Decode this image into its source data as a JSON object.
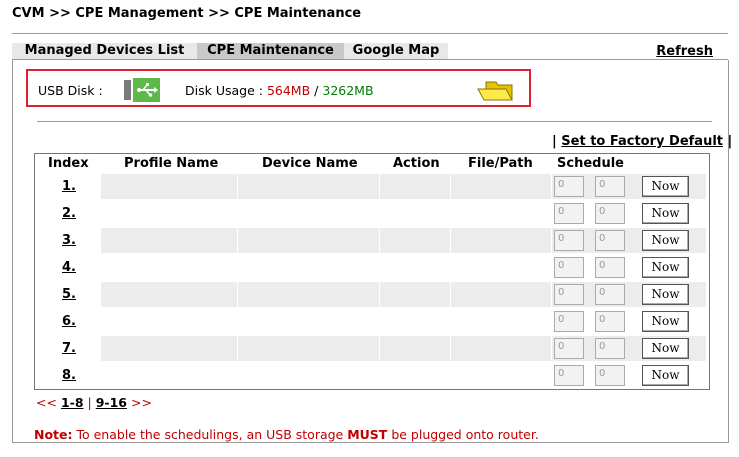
{
  "breadcrumb": "CVM >> CPE Management >> CPE Maintenance",
  "tabs": {
    "managed": "Managed Devices List",
    "maintenance": "CPE Maintenance",
    "map": "Google Map"
  },
  "refresh": "Refresh",
  "usb": {
    "label": "USB Disk :",
    "disk_usage_label": "Disk Usage :",
    "used": "564MB",
    "separator": "/",
    "total": "3262MB"
  },
  "factory": {
    "prefix": "|",
    "label": "Set to Factory Default",
    "suffix": "|"
  },
  "table": {
    "headers": [
      "Index",
      "Profile Name",
      "Device Name",
      "Action",
      "File/Path",
      "Schedule"
    ],
    "rows": [
      {
        "index": "1.",
        "s1": "0",
        "s2": "0",
        "button": "Now"
      },
      {
        "index": "2.",
        "s1": "0",
        "s2": "0",
        "button": "Now"
      },
      {
        "index": "3.",
        "s1": "0",
        "s2": "0",
        "button": "Now"
      },
      {
        "index": "4.",
        "s1": "0",
        "s2": "0",
        "button": "Now"
      },
      {
        "index": "5.",
        "s1": "0",
        "s2": "0",
        "button": "Now"
      },
      {
        "index": "6.",
        "s1": "0",
        "s2": "0",
        "button": "Now"
      },
      {
        "index": "7.",
        "s1": "0",
        "s2": "0",
        "button": "Now"
      },
      {
        "index": "8.",
        "s1": "0",
        "s2": "0",
        "button": "Now"
      }
    ]
  },
  "pager": {
    "prev": "<<",
    "page1": "1-8",
    "sep": "|",
    "page2": "9-16",
    "next": ">>"
  },
  "note": {
    "label": "Note:",
    "text1": " To enable the schedulings, an USB storage ",
    "emphasis": "MUST",
    "text2": " be plugged onto router."
  },
  "colors": {
    "used": "#c00000",
    "total": "#008000",
    "highlight_border": "#e0202e",
    "row_shade": "#ececec"
  }
}
